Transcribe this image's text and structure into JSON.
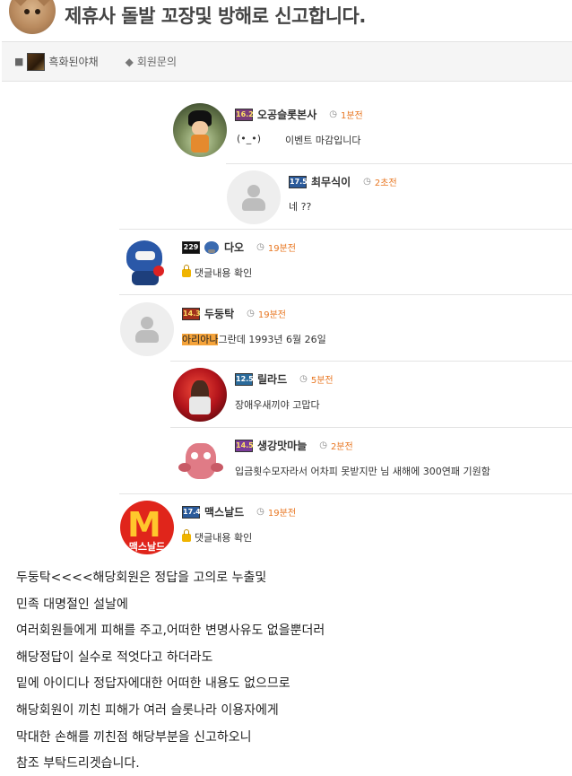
{
  "post": {
    "title": "제휴사 돌발 꼬장및 방해로 신고합니다.",
    "author": "흑화된야채",
    "category": "회원문의"
  },
  "comments": [
    {
      "level": "16.2",
      "nick": "오공슬롯본사",
      "time": "1분전",
      "kaomoji": "(•_•)",
      "text": "이벤트 마감입니다"
    },
    {
      "level": "17.5",
      "nick": "최무식이",
      "time": "2초전",
      "text": "네 ??"
    },
    {
      "level": "229",
      "nick": "다오",
      "time": "19분전",
      "text": "댓글내용 확인"
    },
    {
      "level": "14.3",
      "nick": "두둥탁",
      "time": "19분전",
      "highlight": "아리아나",
      "text": "그란데 1993년 6월 26일"
    },
    {
      "level": "12.5",
      "nick": "릴라드",
      "time": "5분전",
      "text": "장애우새끼야 고맙다"
    },
    {
      "level": "14.5",
      "nick": "생강맛마늘",
      "time": "2분전",
      "text": "입금횟수모자라서 어차피 못받지만 님 새해에 300연패 기원함"
    },
    {
      "level": "17.4",
      "nick": "맥스날드",
      "time": "19분전",
      "text": "댓글내용 확인"
    }
  ],
  "mcd_avatar_text": "맥스날드",
  "body_lines": [
    "두둥탁<<<<해당회원은 정답을 고의로 누출및",
    "민족 대명절인 설날에",
    "여러회원들에게 피해를 주고,어떠한 변명사유도 없을뿐더러",
    "해당정답이 실수로 적엇다고 하더라도",
    "밑에 아이디나 정답자에대한 어떠한 내용도 없으므로",
    "해당회원이 끼친 피해가 여러 슬롯나라 이용자에게",
    "막대한 손해를 끼친점 해당부분을 신고하오니",
    "참조 부탁드리겟습니다."
  ]
}
